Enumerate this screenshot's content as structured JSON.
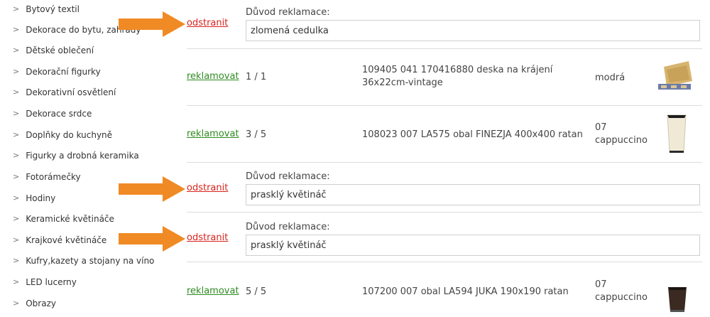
{
  "sidebar": {
    "items": [
      {
        "label": "Bytový textil"
      },
      {
        "label": "Dekorace do bytu, zahrady"
      },
      {
        "label": "Dětské oblečení"
      },
      {
        "label": "Dekorační figurky"
      },
      {
        "label": "Dekorativní osvětlení"
      },
      {
        "label": "Dekorace srdce"
      },
      {
        "label": "Doplňky do kuchyně"
      },
      {
        "label": "Figurky a drobná keramika"
      },
      {
        "label": "Fotorámečky"
      },
      {
        "label": "Hodiny"
      },
      {
        "label": "Keramické květináče"
      },
      {
        "label": "Krajkové květináče"
      },
      {
        "label": "Kufry,kazety a stojany na víno"
      },
      {
        "label": "LED lucerny"
      },
      {
        "label": "Obrazy"
      }
    ]
  },
  "claims": [
    {
      "remove_label": "odstranit",
      "reason_label": "Důvod reklamace:",
      "reason_value": "zlomená cedulka"
    },
    {
      "remove_label": "odstranit",
      "reason_label": "Důvod reklamace:",
      "reason_value": "prasklý květináč"
    },
    {
      "remove_label": "odstranit",
      "reason_label": "Důvod reklamace:",
      "reason_value": "prasklý květináč"
    }
  ],
  "products": [
    {
      "action_label": "reklamovat",
      "qty": "1 / 1",
      "name": "109405 041 170416880 deska na krájení 36x22cm-vintage",
      "color": "modrá"
    },
    {
      "action_label": "reklamovat",
      "qty": "3 / 5",
      "name": "108023 007 LA575 obal FINEZJA 400x400 ratan",
      "color": "07 cappuccino"
    },
    {
      "action_label": "reklamovat",
      "qty": "5 / 5",
      "name": "107200 007 obal LA594 JUKA 190x190 ratan",
      "color": "07 cappuccino"
    }
  ],
  "colors": {
    "remove_link": "#d9231d",
    "claim_link": "#2e8b20",
    "arrow": "#f08a24"
  }
}
